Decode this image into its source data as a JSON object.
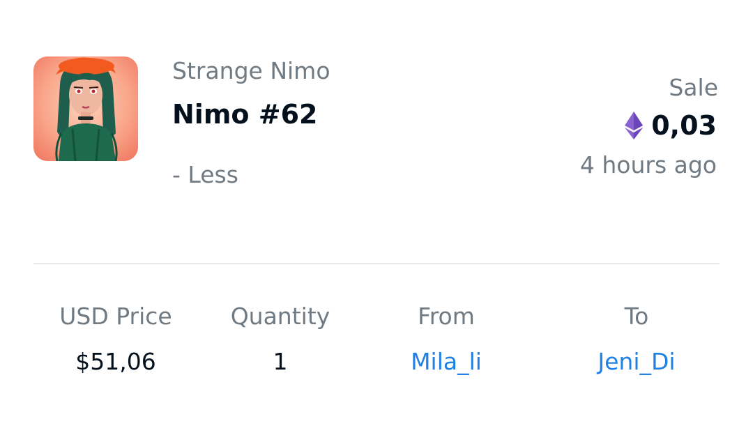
{
  "item": {
    "collection": "Strange Nimo",
    "name": "Nimo #62",
    "toggle_label": "- Less",
    "thumbnail_icon": "nft-avatar-image"
  },
  "event": {
    "type": "Sale",
    "currency_icon": "ethereum-icon",
    "price": "0,03",
    "time": "4 hours ago"
  },
  "details": {
    "usd_price_label": "USD Price",
    "usd_price_value": "$51,06",
    "quantity_label": "Quantity",
    "quantity_value": "1",
    "from_label": "From",
    "from_value": "Mila_li",
    "to_label": "To",
    "to_value": "Jeni_Di"
  },
  "colors": {
    "primary_text": "#04111d",
    "secondary_text": "#707a83",
    "link": "#2081e2",
    "divider": "#e5e8eb",
    "ethereum": "#8a63d2"
  }
}
